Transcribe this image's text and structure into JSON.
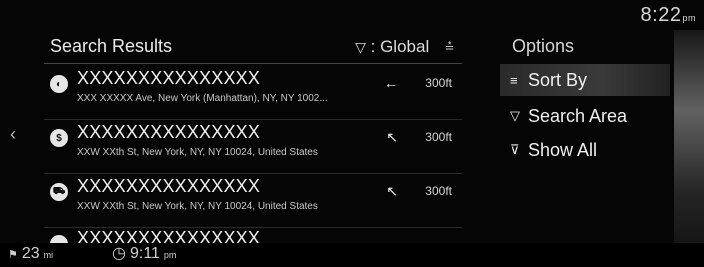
{
  "status": {
    "time": "8:22",
    "ampm": "pm"
  },
  "results": {
    "title": "Search Results",
    "filter_label": ": Global",
    "items": [
      {
        "icon": "restaurant-icon",
        "glyph": "◐",
        "name": "XXXXXXXXXXXXXXX",
        "address": "XXX XXXXX Ave, New York (Manhattan), NY, NY 1002...",
        "direction_glyph": "←",
        "distance": "300ft"
      },
      {
        "icon": "bank-icon",
        "glyph": "$",
        "name": "XXXXXXXXXXXXXXX",
        "address": "XXW XXth St, New York, NY, NY 10024, United States",
        "direction_glyph": "↖",
        "distance": "300ft"
      },
      {
        "icon": "shopping-cart-icon",
        "glyph": "⛟",
        "name": "XXXXXXXXXXXXXXX",
        "address": "XXW XXth St, New York, NY, NY 10024, United States",
        "direction_glyph": "↖",
        "distance": "300ft"
      },
      {
        "icon": "poi-icon",
        "glyph": "",
        "name": "XXXXXXXXXXXXXXX",
        "address": "",
        "direction_glyph": "",
        "distance": ""
      }
    ]
  },
  "options": {
    "title": "Options",
    "items": [
      {
        "label": "Sort By",
        "icon": "sort-icon",
        "glyph": "≡"
      },
      {
        "label": "Search Area",
        "icon": "funnel-icon",
        "glyph": "▽"
      },
      {
        "label": "Show All",
        "icon": "funnel-clear-icon",
        "glyph": "⊽"
      }
    ]
  },
  "bottom": {
    "distance_value": "23",
    "distance_unit": "mi",
    "arrival_time": "9:11",
    "arrival_ampm": "pm"
  }
}
